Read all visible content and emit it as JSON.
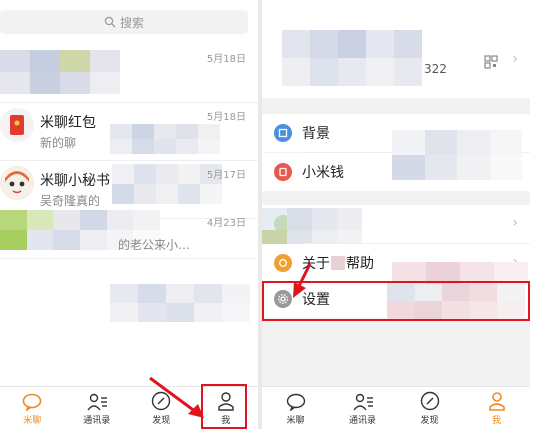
{
  "left": {
    "search": {
      "placeholder": "搜索"
    },
    "chats": [
      {
        "date": "5月18日",
        "name": "",
        "preview": ""
      },
      {
        "date": "5月18日",
        "name": "米聊红包",
        "preview": "新的聊"
      },
      {
        "date": "5月17日",
        "name": "米聊小秘书",
        "preview": "吴奇隆真的"
      },
      {
        "date": "4月23日",
        "name": "",
        "preview": "的老公来小…"
      }
    ],
    "tabs": [
      {
        "label": "米聊",
        "icon": "chat-bubble-icon"
      },
      {
        "label": "通讯录",
        "icon": "contacts-icon"
      },
      {
        "label": "发现",
        "icon": "compass-icon"
      },
      {
        "label": "我",
        "icon": "person-icon"
      }
    ]
  },
  "right": {
    "profile": {
      "id_suffix": "322"
    },
    "rows": [
      {
        "label": "背景",
        "icon": "background-icon",
        "color": "#4a8fe0"
      },
      {
        "label": "小米钱",
        "icon": "wallet-icon",
        "color": "#e85a4f"
      },
      {
        "label": "",
        "icon": "green-icon",
        "color": "#8bc34a"
      },
      {
        "label": "关于",
        "label2": "帮助",
        "icon": "help-icon",
        "color": "#f0a030"
      },
      {
        "label": "设置",
        "icon": "settings-gear-icon",
        "color": "#999999"
      }
    ],
    "tabs": [
      {
        "label": "米聊",
        "icon": "chat-bubble-icon"
      },
      {
        "label": "通讯录",
        "icon": "contacts-icon"
      },
      {
        "label": "发现",
        "icon": "compass-icon"
      },
      {
        "label": "我",
        "icon": "person-icon"
      }
    ]
  },
  "colors": {
    "accent": "#f08a24",
    "highlight": "#e0141e"
  }
}
